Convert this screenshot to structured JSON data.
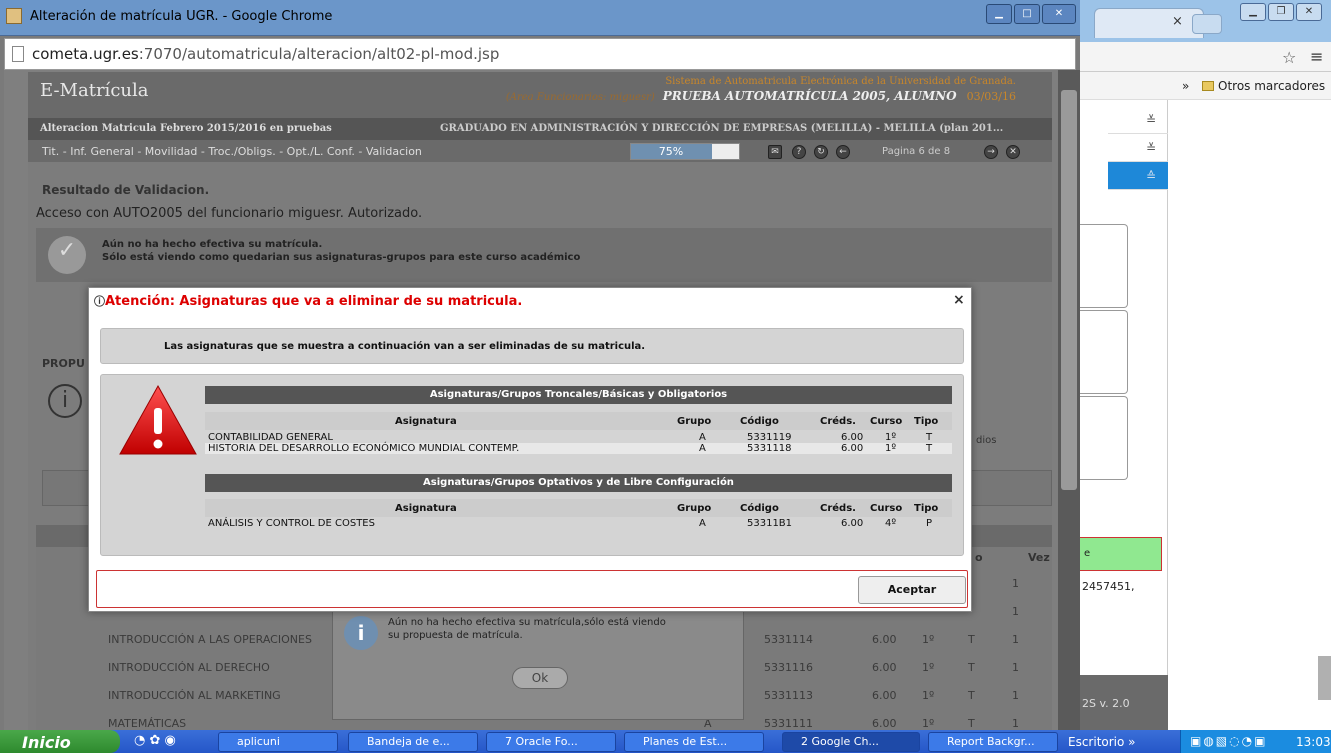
{
  "window": {
    "title": "Alteración de matrícula UGR. - Google Chrome",
    "url_host": "cometa.ugr.es",
    "url_path": ":7070/automatricula/alteracion/alt02-pl-mod.jsp"
  },
  "back_window": {
    "tab_close": "×",
    "bookmarks_more": "»",
    "bookmarks_folder": "Otros marcadores"
  },
  "header": {
    "app_name": "E-Matrícula",
    "system_name": "Sistema de Automatricula Electrónica de la Universidad de Granada.",
    "system_sub": "(Area Funcionarios: miguesr)",
    "prueba": "PRUEBA AUTOMATRÍCULA 2005, ALUMNO",
    "date": "03/03/16",
    "alteracion": "Alteracion Matricula Febrero 2015/2016 en pruebas",
    "grado": "GRADUADO EN ADMINISTRACIÓN Y DIRECCIÓN DE EMPRESAS (MELILLA) - MELILLA (plan 201...",
    "nav": "Tit. - Inf. General - Movilidad - Troc./Obligs. - Opt./L. Conf. - Validacion",
    "progress_label": "75%",
    "progress": 0.75,
    "pagina": "Pagina 6 de 8"
  },
  "content": {
    "resultado": "Resultado de Validacion.",
    "acceso": "Acceso con AUTO2005 del funcionario miguesr. Autorizado.",
    "no_efectiva_1": "Aún no ha hecho efectiva su matrícula.",
    "no_efectiva_2": "Sólo está viendo como quedarian sus asignaturas-grupos para este curso académico",
    "propu": "PROPU",
    "dios": "dios",
    "vez": "Vez",
    "o": "o",
    "rows": [
      {
        "nombre": "",
        "grupo": "",
        "codigo": "",
        "creds": "",
        "curso": "",
        "tipo": "",
        "vez": "1"
      },
      {
        "nombre": "",
        "grupo": "",
        "codigo": "",
        "creds": "",
        "curso": "",
        "tipo": "",
        "vez": "1"
      },
      {
        "nombre": "INTRODUCCIÓN A LAS OPERACIONES",
        "grupo": "",
        "codigo": "5331114",
        "creds": "6.00",
        "curso": "1º",
        "tipo": "T",
        "vez": "1"
      },
      {
        "nombre": "INTRODUCCIÓN AL DERECHO",
        "grupo": "",
        "codigo": "5331116",
        "creds": "6.00",
        "curso": "1º",
        "tipo": "T",
        "vez": "1"
      },
      {
        "nombre": "INTRODUCCIÓN AL MARKETING",
        "grupo": "",
        "codigo": "5331113",
        "creds": "6.00",
        "curso": "1º",
        "tipo": "T",
        "vez": "1"
      },
      {
        "nombre": "MATEMÁTICAS",
        "grupo": "A",
        "codigo": "5331111",
        "creds": "6.00",
        "curso": "1º",
        "tipo": "T",
        "vez": "1"
      }
    ],
    "ok_text_1": "Aún no ha hecho efectiva su matrícula,sólo está viendo",
    "ok_text_2": "su propuesta de matrícula.",
    "ok_button": "Ok"
  },
  "modal": {
    "title": "Atención: Asignaturas que va a eliminar de su matricula.",
    "close": "×",
    "intro": "Las asignaturas que se muestra a continuación van a ser eliminadas de su matricula.",
    "table1_title": "Asignaturas/Grupos Troncales/Básicas y Obligatorios",
    "table2_title": "Asignaturas/Grupos Optativos y de Libre Configuración",
    "columns": {
      "asignatura": "Asignatura",
      "grupo": "Grupo",
      "codigo": "Código",
      "creds": "Créds.",
      "curso": "Curso",
      "tipo": "Tipo"
    },
    "table1": [
      {
        "asignatura": "CONTABILIDAD GENERAL",
        "grupo": "A",
        "codigo": "5331119",
        "creds": "6.00",
        "curso": "1º",
        "tipo": "T"
      },
      {
        "asignatura": "HISTORIA DEL DESARROLLO ECONÓMICO MUNDIAL CONTEMP.",
        "grupo": "A",
        "codigo": "5331118",
        "creds": "6.00",
        "curso": "1º",
        "tipo": "T"
      }
    ],
    "table2": [
      {
        "asignatura": "ANÁLISIS Y CONTROL DE COSTES",
        "grupo": "A",
        "codigo": "53311B1",
        "creds": "6.00",
        "curso": "4º",
        "tipo": "P"
      }
    ],
    "accept": "Aceptar"
  },
  "right": {
    "green_label": "e",
    "number": "2457451,",
    "version": "2S v. 2.0"
  },
  "taskbar": {
    "start": "Inicio",
    "items": [
      "aplicuni",
      "Bandeja de e...",
      "7 Oracle Fo...",
      "Planes de Est...",
      "2 Google Ch...",
      "Report Backgr..."
    ],
    "escritorio": "Escritorio",
    "clock": "13:03"
  }
}
